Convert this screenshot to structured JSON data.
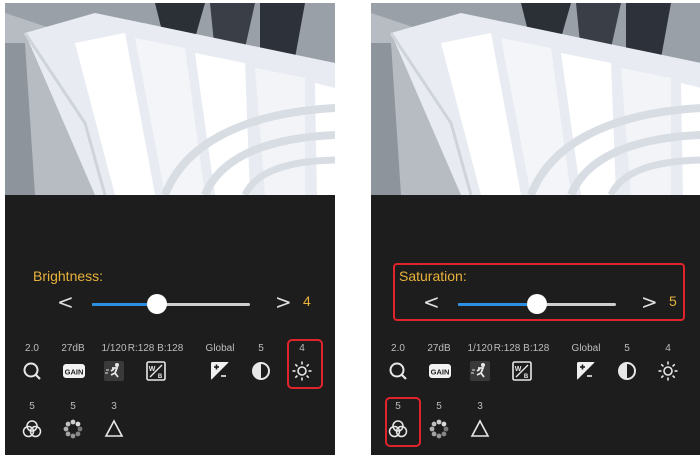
{
  "left_panel": {
    "slider_label": "Brightness:",
    "slider_value": "4",
    "slider_fraction": 0.41,
    "prev_arrow": "<",
    "next_arrow": ">",
    "tools": [
      {
        "value": "2.0",
        "icon": "zoom-icon",
        "highlighted": false
      },
      {
        "value": "27dB",
        "icon": "gain-icon",
        "highlighted": false
      },
      {
        "value": "1/120",
        "icon": "shutter-motion-icon",
        "highlighted": false
      },
      {
        "value": "R:128 B:128",
        "icon": "white-balance-icon",
        "highlighted": false
      },
      {
        "value": "Global",
        "icon": "exposure-icon",
        "highlighted": false
      },
      {
        "value": "5",
        "icon": "contrast-icon",
        "highlighted": false
      },
      {
        "value": "4",
        "icon": "brightness-icon",
        "highlighted": true
      },
      {
        "value": "5",
        "icon": "saturation-icon",
        "highlighted": false
      },
      {
        "value": "5",
        "icon": "sharpness-icon",
        "highlighted": false
      },
      {
        "value": "3",
        "icon": "gamma-icon",
        "highlighted": false
      }
    ]
  },
  "right_panel": {
    "slider_label": "Saturation:",
    "slider_value": "5",
    "slider_fraction": 0.5,
    "prev_arrow": "<",
    "next_arrow": ">",
    "tools": [
      {
        "value": "2.0",
        "icon": "zoom-icon",
        "highlighted": false
      },
      {
        "value": "27dB",
        "icon": "gain-icon",
        "highlighted": false
      },
      {
        "value": "1/120",
        "icon": "shutter-motion-icon",
        "highlighted": false
      },
      {
        "value": "R:128 B:128",
        "icon": "white-balance-icon",
        "highlighted": false
      },
      {
        "value": "Global",
        "icon": "exposure-icon",
        "highlighted": false
      },
      {
        "value": "5",
        "icon": "contrast-icon",
        "highlighted": false
      },
      {
        "value": "4",
        "icon": "brightness-icon",
        "highlighted": false
      },
      {
        "value": "5",
        "icon": "saturation-icon",
        "highlighted": true
      },
      {
        "value": "5",
        "icon": "sharpness-icon",
        "highlighted": false
      },
      {
        "value": "3",
        "icon": "gamma-icon",
        "highlighted": false
      }
    ]
  },
  "icon_labels": {
    "gain": "GAIN",
    "wb_w": "W",
    "wb_b": "B"
  },
  "colors": {
    "accent_text": "#e8b23a",
    "slider_fill": "#2b8fe6",
    "highlight_border": "#e0252a",
    "panel_bg": "#1d1d1d"
  }
}
